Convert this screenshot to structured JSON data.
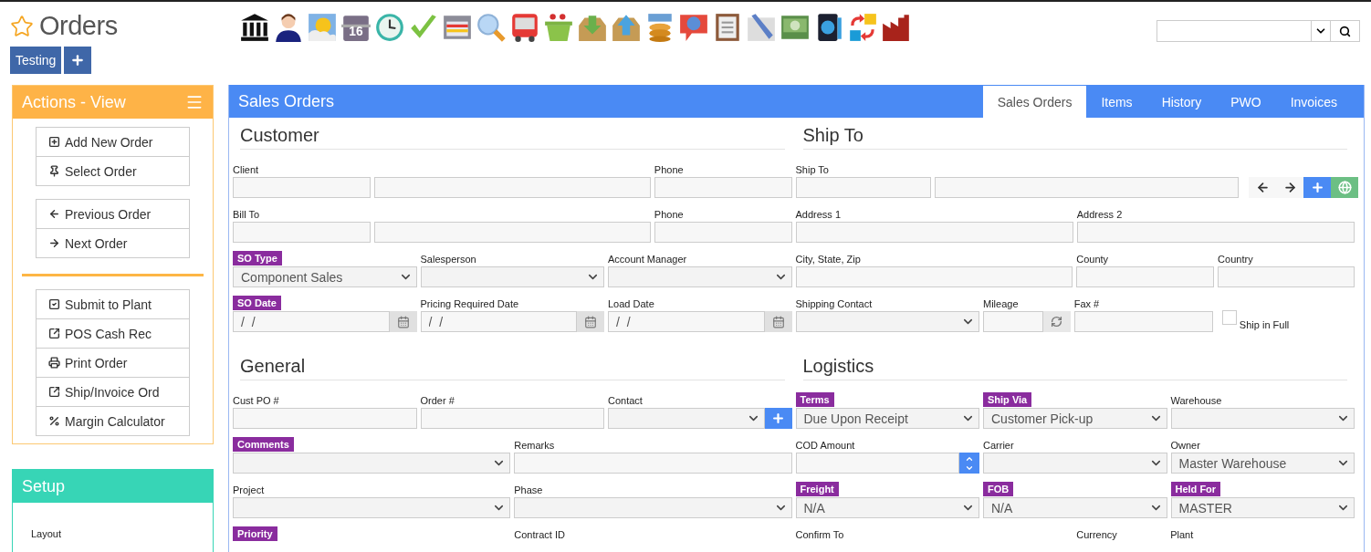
{
  "page": {
    "title": "Orders",
    "starred": false
  },
  "workspace_tabs": [
    {
      "label": "Testing"
    }
  ],
  "toolbar": {
    "calendar_day": "16"
  },
  "actions": {
    "title": "Actions - View",
    "groups": [
      {
        "separated": false,
        "items": [
          {
            "label": "Add New Order",
            "kind": "add"
          },
          {
            "label": "Select Order",
            "kind": "pin"
          }
        ]
      },
      {
        "separated": false,
        "items": [
          {
            "label": "Previous Order",
            "kind": "previous"
          },
          {
            "label": "Next Order",
            "kind": "next"
          }
        ]
      },
      {
        "separated": true,
        "items": [
          {
            "label": "Submit to Plant",
            "kind": "check"
          },
          {
            "label": "POS Cash Rec",
            "kind": "link"
          },
          {
            "label": "Print Order",
            "kind": "print"
          },
          {
            "label": "Ship/Invoice Ord",
            "kind": "link"
          },
          {
            "label": "Margin Calculator",
            "kind": "percent"
          }
        ]
      }
    ]
  },
  "setup": {
    "title": "Setup",
    "items": [
      "Layout"
    ]
  },
  "main": {
    "title": "Sales Orders",
    "tabs": [
      {
        "label": "Sales Orders",
        "selected": true
      },
      {
        "label": "Items",
        "selected": false
      },
      {
        "label": "History",
        "selected": false
      },
      {
        "label": "PWO",
        "selected": false
      },
      {
        "label": "Invoices",
        "selected": false
      }
    ],
    "sections": [
      {
        "title": "Customer",
        "rows": [
          {
            "fields": [
              {
                "label": "Client",
                "highlighted": false,
                "kind": "text"
              },
              {
                "kind": "text"
              },
              {
                "label": "Phone",
                "highlighted": false,
                "kind": "text"
              }
            ]
          },
          {
            "fields": [
              {
                "label": "Bill To",
                "highlighted": false,
                "kind": "text"
              },
              {
                "kind": "text"
              },
              {
                "label": "Phone",
                "highlighted": false,
                "kind": "text"
              }
            ]
          },
          {
            "fields": [
              {
                "label": "SO Type",
                "highlighted": true,
                "kind": "select",
                "value": "Component Sales"
              },
              {
                "label": "Salesperson",
                "highlighted": false,
                "kind": "select"
              },
              {
                "label": "Account Manager",
                "highlighted": false,
                "kind": "select"
              }
            ]
          },
          {
            "fields": [
              {
                "label": "SO Date",
                "highlighted": true,
                "kind": "date",
                "value": "/  /"
              },
              {
                "label": "Pricing Required Date",
                "highlighted": false,
                "kind": "date",
                "value": "/  /"
              },
              {
                "label": "Load Date",
                "highlighted": false,
                "kind": "date",
                "value": "/  /"
              }
            ]
          }
        ]
      },
      {
        "title": "Ship To",
        "rows": [
          {
            "fields": [
              {
                "label": "Ship To",
                "highlighted": false,
                "kind": "text"
              },
              {
                "kind": "text"
              },
              {
                "kind": "nav"
              }
            ]
          },
          {
            "fields": [
              {
                "label": "Address 1",
                "highlighted": false,
                "kind": "text"
              },
              {
                "label": "Address 2",
                "highlighted": false,
                "kind": "text"
              }
            ]
          },
          {
            "fields": [
              {
                "label": "City, State, Zip",
                "highlighted": false,
                "kind": "text"
              },
              {
                "label": "County",
                "highlighted": false,
                "kind": "text"
              },
              {
                "label": "Country",
                "highlighted": false,
                "kind": "text"
              }
            ]
          },
          {
            "fields": [
              {
                "label": "Shipping Contact",
                "highlighted": false,
                "kind": "select"
              },
              {
                "label": "Mileage",
                "highlighted": false,
                "kind": "refresh"
              },
              {
                "label": "Fax #",
                "highlighted": false,
                "kind": "text"
              },
              {
                "label": "Ship in Full",
                "kind": "checkbox",
                "checked": false
              }
            ]
          }
        ]
      },
      {
        "title": "General",
        "rows": [
          {
            "fields": [
              {
                "label": "Cust PO #",
                "highlighted": false,
                "kind": "text"
              },
              {
                "label": "Order #",
                "highlighted": false,
                "kind": "text"
              },
              {
                "label": "Contact",
                "highlighted": false,
                "kind": "select_add"
              }
            ]
          },
          {
            "fields": [
              {
                "label": "Comments",
                "highlighted": true,
                "kind": "select"
              },
              {
                "label": "Remarks",
                "highlighted": false,
                "kind": "text"
              }
            ]
          },
          {
            "fields": [
              {
                "label": "Project",
                "highlighted": false,
                "kind": "select"
              },
              {
                "label": "Phase",
                "highlighted": false,
                "kind": "select"
              }
            ]
          },
          {
            "fields": [
              {
                "label": "Priority",
                "highlighted": true
              },
              {
                "label": "Contract ID",
                "highlighted": false
              }
            ]
          }
        ]
      },
      {
        "title": "Logistics",
        "rows": [
          {
            "fields": [
              {
                "label": "Terms",
                "highlighted": true,
                "kind": "select",
                "value": "Due Upon Receipt"
              },
              {
                "label": "Ship Via",
                "highlighted": true,
                "kind": "select",
                "value": "Customer Pick-up"
              },
              {
                "label": "Warehouse",
                "highlighted": false,
                "kind": "select"
              }
            ]
          },
          {
            "fields": [
              {
                "label": "COD Amount",
                "highlighted": false,
                "kind": "spinner"
              },
              {
                "label": "Carrier",
                "highlighted": false,
                "kind": "select"
              },
              {
                "label": "Owner",
                "highlighted": false,
                "kind": "select",
                "value": "Master Warehouse"
              }
            ]
          },
          {
            "fields": [
              {
                "label": "Freight",
                "highlighted": true,
                "kind": "select",
                "value": "N/A"
              },
              {
                "label": "FOB",
                "highlighted": true,
                "kind": "select",
                "value": "N/A"
              },
              {
                "label": "Held For",
                "highlighted": true,
                "kind": "select",
                "value": "MASTER"
              }
            ]
          },
          {
            "fields": [
              {
                "label": "Confirm To",
                "highlighted": false
              },
              {
                "label": "Currency",
                "highlighted": false
              },
              {
                "label": "Plant",
                "highlighted": false
              }
            ]
          }
        ]
      }
    ]
  }
}
